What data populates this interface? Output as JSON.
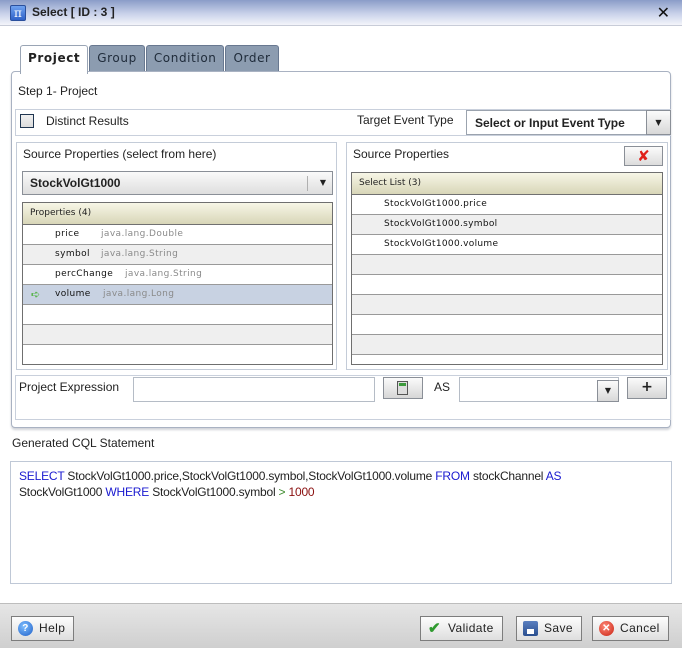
{
  "window": {
    "title": "Select [ ID : 3 ]",
    "app_icon": "pi-icon",
    "close_glyph": "✕"
  },
  "tabs": [
    {
      "label": "Project",
      "active": true
    },
    {
      "label": "Group",
      "active": false
    },
    {
      "label": "Condition",
      "active": false
    },
    {
      "label": "Order",
      "active": false
    }
  ],
  "project": {
    "step_label": "Step 1- Project",
    "distinct": {
      "label": "Distinct Results",
      "checked": false
    },
    "target_event": {
      "label": "Target Event Type",
      "value": "Select or Input Event Type"
    },
    "source": {
      "title": "Source Properties (select from here)",
      "selected_source": "StockVolGt1000",
      "grid_header": "Properties (4)",
      "rows": [
        {
          "name": "price",
          "type": "java.lang.Double",
          "selected": false
        },
        {
          "name": "symbol",
          "type": "java.lang.String",
          "selected": false
        },
        {
          "name": "percChange",
          "type": "java.lang.String",
          "selected": false
        },
        {
          "name": "volume",
          "type": "java.lang.Long",
          "selected": true
        }
      ]
    },
    "target": {
      "title": "Source Properties",
      "remove_glyph": "✘",
      "grid_header": "Select List (3)",
      "rows": [
        "StockVolGt1000.price",
        "StockVolGt1000.symbol",
        "StockVolGt1000.volume"
      ]
    },
    "expression": {
      "label": "Project Expression",
      "value": "",
      "as_label": "AS",
      "as_value": "",
      "add_glyph": "+"
    }
  },
  "cql": {
    "label": "Generated CQL Statement",
    "tokens": [
      {
        "t": "SELECT",
        "c": "kw"
      },
      {
        "t": " StockVolGt1000.price,StockVolGt1000.symbol,StockVolGt1000.volume ",
        "c": ""
      },
      {
        "t": "FROM",
        "c": "kw"
      },
      {
        "t": " stockChannel ",
        "c": ""
      },
      {
        "t": "AS",
        "c": "kw"
      },
      {
        "t": "\nStockVolGt1000 ",
        "c": ""
      },
      {
        "t": "WHERE",
        "c": "kw"
      },
      {
        "t": " StockVolGt1000.symbol ",
        "c": ""
      },
      {
        "t": ">",
        "c": "op"
      },
      {
        "t": " ",
        "c": ""
      },
      {
        "t": "1000",
        "c": "num"
      }
    ]
  },
  "footer": {
    "help": "Help",
    "validate": "Validate",
    "save": "Save",
    "cancel": "Cancel"
  }
}
